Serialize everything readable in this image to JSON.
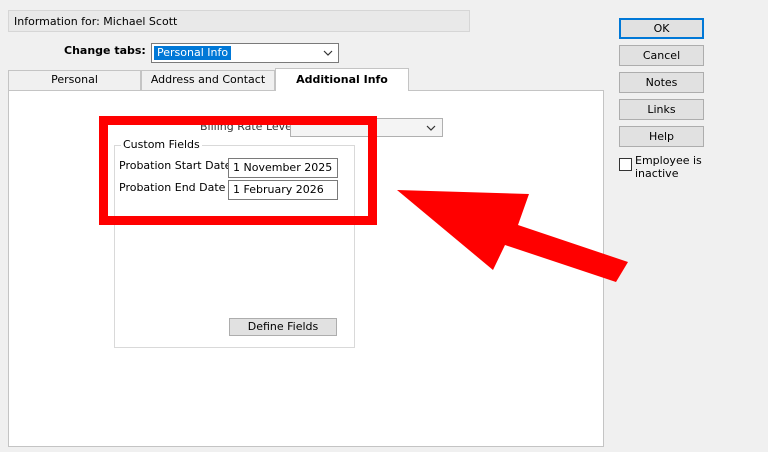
{
  "header": {
    "info_text": "Information for: Michael Scott"
  },
  "change_tabs": {
    "label": "Change tabs:",
    "selected": "Personal Info"
  },
  "tabs": [
    {
      "label": "Personal",
      "active": false
    },
    {
      "label": "Address and Contact",
      "active": false
    },
    {
      "label": "Additional Info",
      "active": true
    }
  ],
  "billing_rate": {
    "label": "Billing Rate Level",
    "value": ""
  },
  "custom_fields": {
    "title": "Custom Fields",
    "start_label": "Probation Start Date",
    "start_value": "1 November 2025",
    "end_label": "Probation End Date",
    "end_value": "1 February 2026",
    "define_button": "Define Fields"
  },
  "side_buttons": {
    "ok": "OK",
    "cancel": "Cancel",
    "notes": "Notes",
    "links": "Links",
    "help": "Help"
  },
  "employee_inactive": {
    "label": "Employee is inactive",
    "checked": false
  },
  "colors": {
    "highlight": "#ff0000",
    "selection": "#0078d7"
  }
}
